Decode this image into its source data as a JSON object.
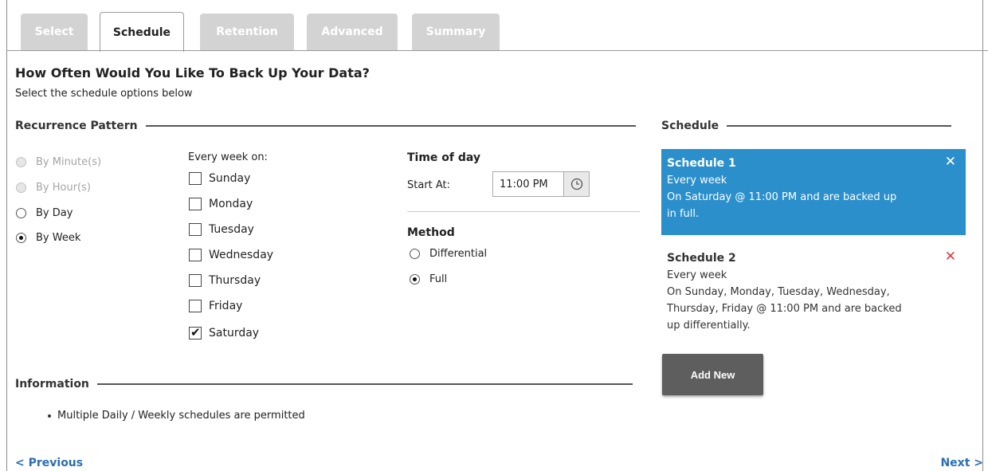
{
  "tabs": [
    {
      "label": "Select",
      "active": false
    },
    {
      "label": "Schedule",
      "active": true
    },
    {
      "label": "Retention",
      "active": false
    },
    {
      "label": "Advanced",
      "active": false
    },
    {
      "label": "Summary",
      "active": false
    }
  ],
  "header": {
    "title": "How Often Would You Like To Back Up Your Data?",
    "subtitle": "Select the schedule options below"
  },
  "recurrence": {
    "section_label": "Recurrence Pattern",
    "options": [
      {
        "label": "By Minute(s)",
        "selected": false,
        "enabled": false
      },
      {
        "label": "By Hour(s)",
        "selected": false,
        "enabled": false
      },
      {
        "label": "By Day",
        "selected": false,
        "enabled": true
      },
      {
        "label": "By Week",
        "selected": true,
        "enabled": true
      }
    ],
    "week_label": "Every week on:",
    "days": [
      {
        "label": "Sunday",
        "checked": false
      },
      {
        "label": "Monday",
        "checked": false
      },
      {
        "label": "Tuesday",
        "checked": false
      },
      {
        "label": "Wednesday",
        "checked": false
      },
      {
        "label": "Thursday",
        "checked": false
      },
      {
        "label": "Friday",
        "checked": false
      },
      {
        "label": "Saturday",
        "checked": true
      }
    ],
    "time_of_day_label": "Time of day",
    "start_at_label": "Start At:",
    "start_time": "11:00 PM",
    "method_label": "Method",
    "methods": [
      {
        "label": "Differential",
        "selected": false
      },
      {
        "label": "Full",
        "selected": true
      }
    ]
  },
  "schedule": {
    "section_label": "Schedule",
    "items": [
      {
        "title": "Schedule 1",
        "line1": "Every week",
        "line2": "On Saturday @ 11:00 PM and are backed up",
        "line3": "in full.",
        "line4": "",
        "selected": true
      },
      {
        "title": "Schedule 2",
        "line1": "Every week",
        "line2": "On Sunday, Monday, Tuesday, Wednesday,",
        "line3": "Thursday, Friday @ 11:00 PM and are backed",
        "line4": "up differentially.",
        "selected": false
      }
    ],
    "add_label": "Add New"
  },
  "information": {
    "section_label": "Information",
    "items": [
      "Multiple Daily / Weekly schedules are permitted"
    ]
  },
  "nav": {
    "previous": "< Previous",
    "next": "Next >"
  },
  "colors": {
    "accent": "#2b8fcb",
    "link": "#2a6eb0",
    "delete": "#e0393e",
    "tab_inactive": "#d3d3d3",
    "button": "#5e5e5e"
  }
}
